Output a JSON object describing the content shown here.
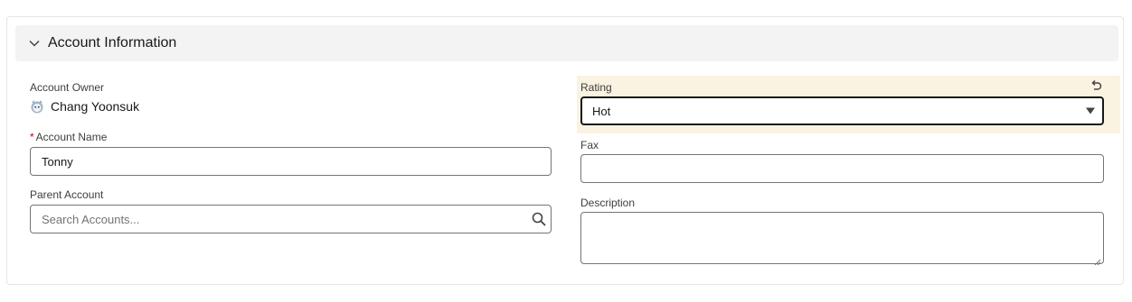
{
  "section": {
    "title": "Account Information"
  },
  "owner": {
    "label": "Account Owner",
    "name": "Chang Yoonsuk"
  },
  "account_name": {
    "required_mark": "*",
    "label": "Account Name",
    "value": "Tonny"
  },
  "parent_account": {
    "label": "Parent Account",
    "placeholder": "Search Accounts..."
  },
  "rating": {
    "label": "Rating",
    "value": "Hot"
  },
  "fax": {
    "label": "Fax",
    "value": ""
  },
  "description": {
    "label": "Description",
    "value": ""
  },
  "icons": {
    "section_toggle": "chevron-down-icon",
    "owner_avatar": "avatar-icon",
    "search": "search-icon",
    "undo": "undo-icon",
    "dropdown": "caret-down-icon",
    "resize": "resize-handle-icon"
  },
  "colors": {
    "header_bg": "#f3f3f3",
    "edited_field_bg": "#faf3e1",
    "required": "#ba0517",
    "border": "#747474"
  }
}
